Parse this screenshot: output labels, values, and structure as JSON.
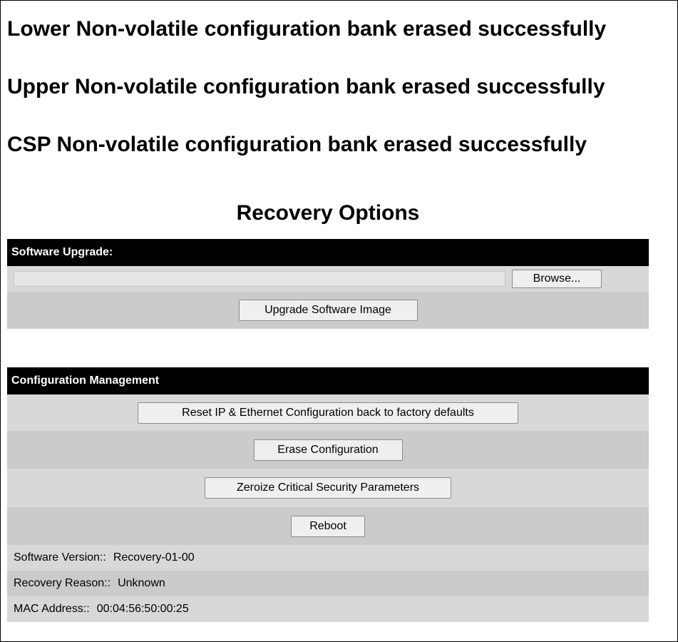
{
  "messages": [
    "Lower Non-volatile configuration bank erased successfully",
    "Upper Non-volatile configuration bank erased successfully",
    "CSP Non-volatile configuration bank erased successfully"
  ],
  "recovery": {
    "title": "Recovery Options"
  },
  "software_upgrade": {
    "header": "Software Upgrade:",
    "file_path_value": "",
    "browse_label": "Browse...",
    "upgrade_label": "Upgrade Software Image"
  },
  "config_management": {
    "header": "Configuration Management",
    "reset_label": "Reset IP & Ethernet Configuration back to factory defaults",
    "erase_label": "Erase Configuration",
    "zeroize_label": "Zeroize Critical Security Parameters",
    "reboot_label": "Reboot"
  },
  "info": {
    "software_version_label": "Software Version::",
    "software_version_value": "Recovery-01-00",
    "recovery_reason_label": "Recovery Reason::",
    "recovery_reason_value": "Unknown",
    "mac_address_label": "MAC Address::",
    "mac_address_value": "00:04:56:50:00:25"
  },
  "colors": {
    "header_bg": "#000000",
    "header_text": "#ffffff",
    "row_bg": "#d8d8d8",
    "row_alt_bg": "#cbcbcb"
  }
}
